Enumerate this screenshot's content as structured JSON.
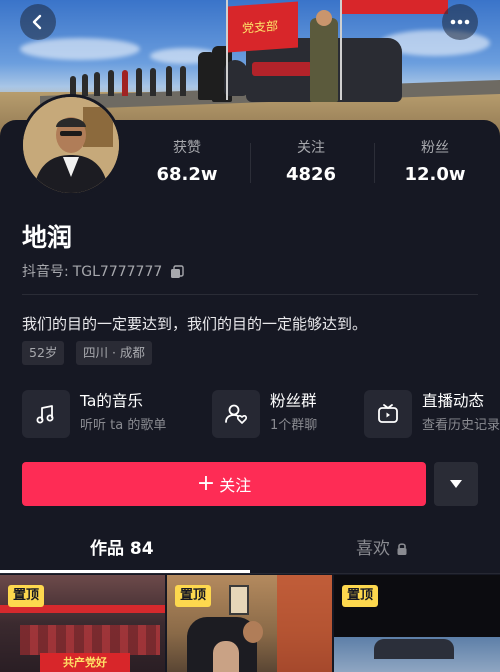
{
  "profile": {
    "name": "地润",
    "douyin_id_label": "抖音号:",
    "douyin_id": "TGL7777777",
    "bio": "我们的目的一定要达到，我们的目的一定能够达到。",
    "tags": [
      "52岁",
      "四川 · 成都"
    ]
  },
  "cover": {
    "flag_text": "党支部"
  },
  "stats": [
    {
      "label": "获赞",
      "value": "68.2w"
    },
    {
      "label": "关注",
      "value": "4826"
    },
    {
      "label": "粉丝",
      "value": "12.0w"
    }
  ],
  "features": [
    {
      "title": "Ta的音乐",
      "subtitle": "听听 ta 的歌单",
      "icon": "music-note-icon"
    },
    {
      "title": "粉丝群",
      "subtitle": "1个群聊",
      "icon": "fan-group-icon"
    },
    {
      "title": "直播动态",
      "subtitle": "查看历史记录",
      "icon": "live-tv-icon"
    }
  ],
  "actions": {
    "follow_label": "关注",
    "dropdown_icon": "triangle-down-icon"
  },
  "tabs": {
    "works_label": "作品 84",
    "likes_label": "喜欢"
  },
  "videos": [
    {
      "pinned_label": "置顶",
      "caption": "共产党好"
    },
    {
      "pinned_label": "置顶"
    },
    {
      "pinned_label": "置顶"
    }
  ],
  "colors": {
    "background": "#161823",
    "follow_button": "#fe2c55",
    "pinned_badge": "#fdd84e"
  }
}
